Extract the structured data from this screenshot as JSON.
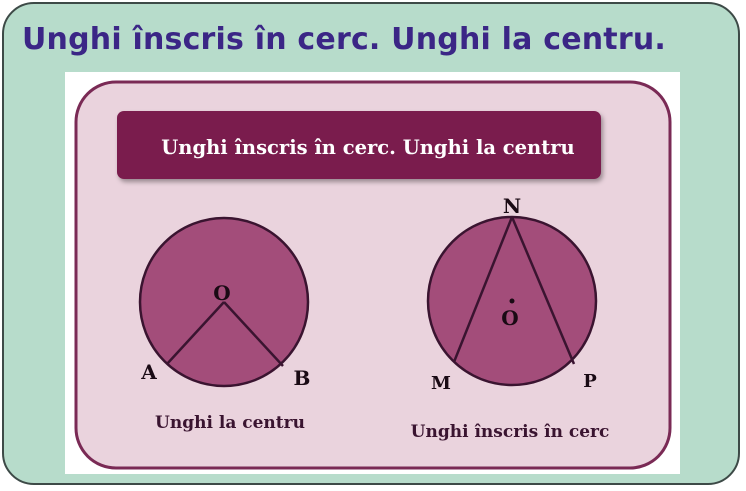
{
  "page": {
    "title": "Unghi înscris în cerc. Unghi la centru."
  },
  "slide": {
    "banner": "Unghi înscris în cerc. Unghi la centru"
  },
  "left_figure": {
    "center_label": "O",
    "point_a": "A",
    "point_b": "B",
    "caption": "Unghi la centru"
  },
  "right_figure": {
    "top_label": "N",
    "center_label": "O",
    "point_m": "M",
    "point_p": "P",
    "caption": "Unghi înscris în cerc"
  },
  "colors": {
    "frame_bg": "#b7dccb",
    "title": "#3b2686",
    "slide_bg": "#ead3dd",
    "slide_border": "#7a2a55",
    "banner": "#7a1d4d",
    "circle_fill": "#a34d7a",
    "caption": "#3a1430"
  }
}
